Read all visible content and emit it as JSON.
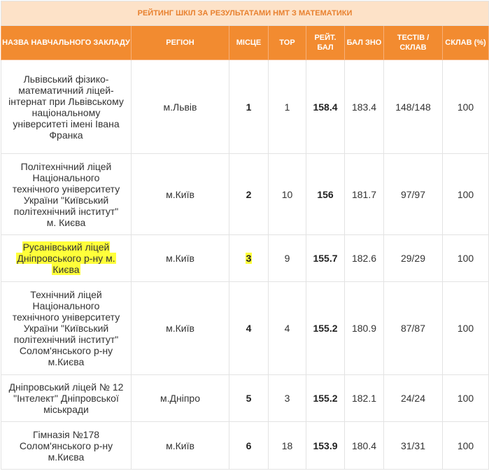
{
  "table_title": "РЕЙТИНГ ШКІЛ ЗА РЕЗУЛЬТАТАМИ НМТ З МАТЕМАТИКИ",
  "headers": {
    "name": "НАЗВА НАВЧАЛЬНОГО ЗАКЛАДУ",
    "region": "РЕГІОН",
    "place": "МІСЦЕ",
    "top": "TOP",
    "rating": "РЕЙТ. БАЛ",
    "zno": "БАЛ ЗНО",
    "tests": "ТЕСТІВ / СКЛАВ",
    "passed": "СКЛАВ (%)"
  },
  "highlight_color": "#ffff3a",
  "header_color": "#f28b30",
  "rows": [
    {
      "name": "Львівський фізико-математичний ліцей-інтернат при Львівському національному університеті імені Івана Франка",
      "region": "м.Львів",
      "place": "1",
      "top": "1",
      "rating": "158.4",
      "zno": "183.4",
      "tests": "148/148",
      "passed": "100",
      "highlighted": false
    },
    {
      "name": "Політехнічний ліцей Національного технічного університету України \"Київський політехнічний інститут\" м. Києва",
      "region": "м.Київ",
      "place": "2",
      "top": "10",
      "rating": "156",
      "zno": "181.7",
      "tests": "97/97",
      "passed": "100",
      "highlighted": false
    },
    {
      "name": "Русанівський ліцей Дніпровського р-ну м. Києва",
      "region": "м.Київ",
      "place": "3",
      "top": "9",
      "rating": "155.7",
      "zno": "182.6",
      "tests": "29/29",
      "passed": "100",
      "highlighted": true
    },
    {
      "name": "Технічний ліцей Національного технічного університету України \"Київський політехнічний інститут\" Солом'янського р-ну м.Києва",
      "region": "м.Київ",
      "place": "4",
      "top": "4",
      "rating": "155.2",
      "zno": "180.9",
      "tests": "87/87",
      "passed": "100",
      "highlighted": false
    },
    {
      "name": "Дніпровський ліцей № 12 \"Інтелект\" Дніпровської міськради",
      "region": "м.Дніпро",
      "place": "5",
      "top": "3",
      "rating": "155.2",
      "zno": "182.1",
      "tests": "24/24",
      "passed": "100",
      "highlighted": false
    },
    {
      "name": "Гімназія №178 Солом'янського р-ну м.Києва",
      "region": "м.Київ",
      "place": "6",
      "top": "18",
      "rating": "153.9",
      "zno": "180.4",
      "tests": "31/31",
      "passed": "100",
      "highlighted": false
    }
  ]
}
